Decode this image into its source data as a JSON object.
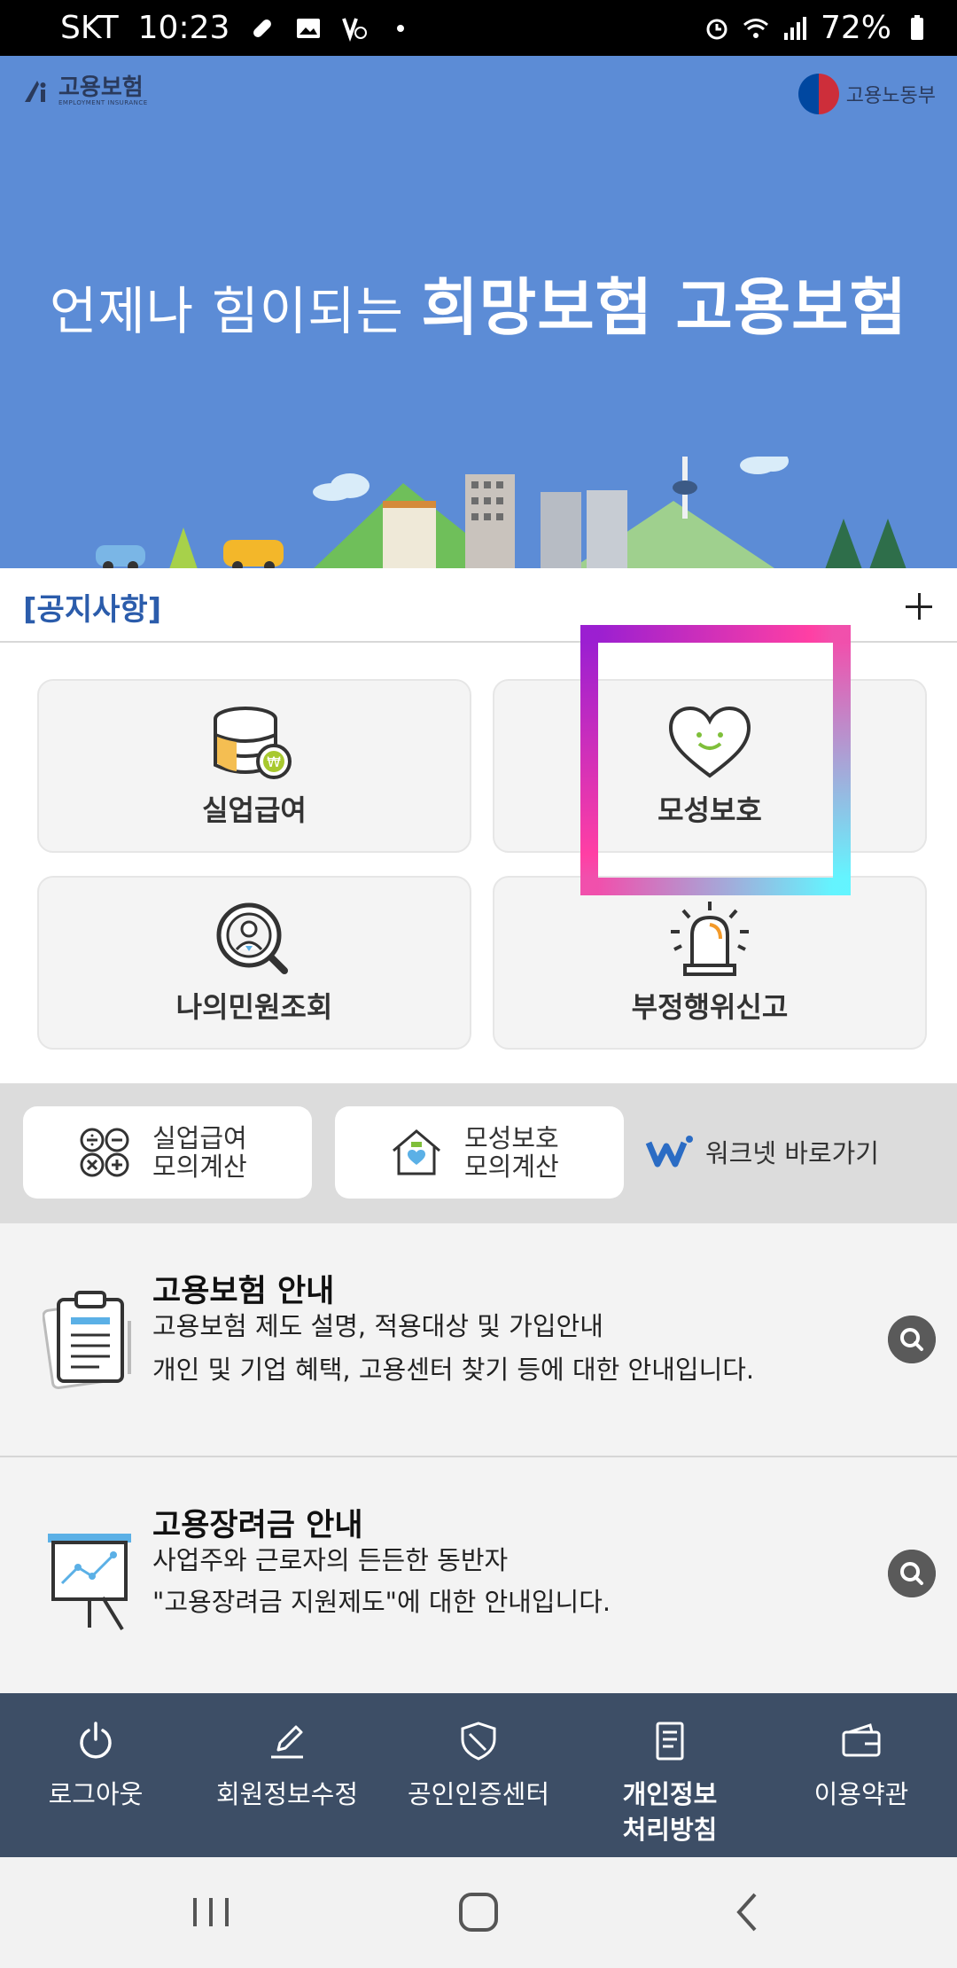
{
  "status_bar": {
    "carrier": "SKT",
    "time": "10:23",
    "battery": "72%",
    "icons": [
      "pill-icon",
      "image-icon",
      "volte-icon",
      "dot-icon",
      "alarm-icon",
      "wifi-icon",
      "signal-icon",
      "battery-icon"
    ]
  },
  "hero": {
    "logo_left": "고용보험",
    "logo_left_sub": "EMPLOYMENT INSURANCE",
    "logo_right": "고용노동부",
    "title_normal": "언제나 힘이되는 ",
    "title_bold": "희망보험 고용보험",
    "bg_color": "#5c8cd6"
  },
  "notice": {
    "label": "[공지사항]",
    "more_icon": "plus-icon"
  },
  "tiles": [
    {
      "label": "실업급여",
      "icon": "coin-database-icon"
    },
    {
      "label": "모성보호",
      "icon": "heart-smile-icon"
    },
    {
      "label": "나의민원조회",
      "icon": "person-search-icon"
    },
    {
      "label": "부정행위신고",
      "icon": "siren-icon"
    }
  ],
  "quick": {
    "unemployment_calc": "실업급여\n모의계산",
    "maternity_calc": "모성보호\n모의계산",
    "worknet": "워크넷 바로가기"
  },
  "info": [
    {
      "title": "고용보험 안내",
      "desc1": "고용보험 제도 설명, 적용대상 및 가입안내",
      "desc2": "개인 및 기업 혜택, 고용센터 찾기 등에 대한 안내입니다.",
      "icon": "clipboard-icon"
    },
    {
      "title": "고용장려금 안내",
      "desc1": "사업주와 근로자의 든든한 동반자",
      "desc2": "\"고용장려금 지원제도\"에 대한 안내입니다.",
      "icon": "presentation-chart-icon"
    }
  ],
  "bottom_nav": [
    {
      "label": "로그아웃",
      "icon": "power-icon"
    },
    {
      "label": "회원정보수정",
      "icon": "edit-icon"
    },
    {
      "label": "공인인증센터",
      "icon": "shield-icon"
    },
    {
      "label": "개인정보\n처리방침",
      "icon": "document-icon"
    },
    {
      "label": "이용약관",
      "icon": "wallet-icon"
    }
  ],
  "colors": {
    "notice_label": "#2b5cab",
    "bottom_nav_bg": "#3d4e66",
    "highlight_gradient": [
      "#9b1fd1",
      "#ff3fa4",
      "#63f5ff"
    ]
  }
}
